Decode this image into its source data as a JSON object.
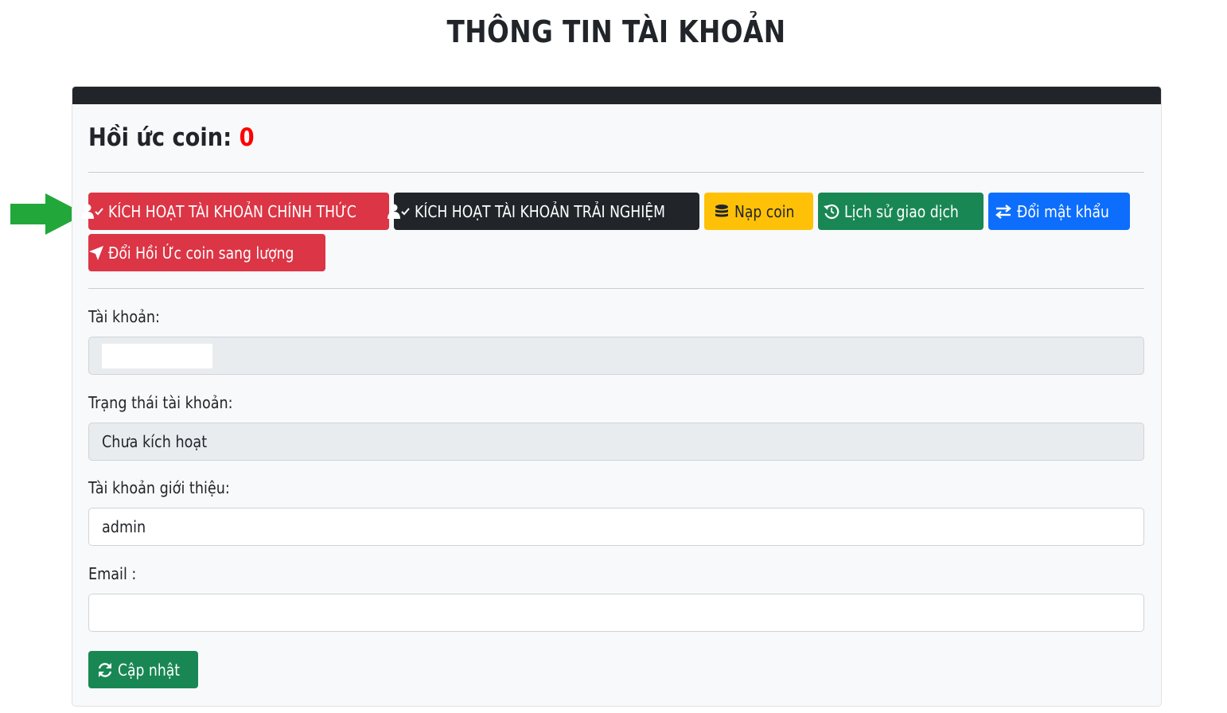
{
  "page": {
    "title": "THÔNG TIN TÀI KHOẢN"
  },
  "coin": {
    "label": "Hồi ức coin:",
    "value": "0"
  },
  "buttons": {
    "activate_official": "KÍCH HOẠT TÀI KHOẢN CHÍNH THỨC",
    "activate_trial": "KÍCH HOẠT TÀI KHOẢN TRẢI NGHIỆM",
    "top_up": "Nạp coin",
    "history": "Lịch sử giao dịch",
    "change_password": "Đổi mật khẩu",
    "convert_coin": "Đổi Hồi Ức coin sang lượng",
    "update": "Cập nhật"
  },
  "form": {
    "account_label": "Tài khoản:",
    "account_value": "",
    "status_label": "Trạng thái tài khoản:",
    "status_value": "Chưa kích hoạt",
    "referrer_label": "Tài khoản giới thiệu:",
    "referrer_value": "admin",
    "email_label": "Email :",
    "email_value": ""
  },
  "icons": {
    "activate_official": "user-check-icon",
    "activate_trial": "user-check-icon",
    "top_up": "coins-icon",
    "history": "history-icon",
    "change_password": "exchange-icon",
    "convert_coin": "location-arrow-icon",
    "update": "refresh-icon",
    "annotations": "green-arrow-icon"
  },
  "colors": {
    "danger": "#dc3545",
    "dark": "#212529",
    "warning": "#ffc107",
    "success": "#198754",
    "primary": "#0d6efd",
    "coin_value": "#ff0000",
    "annotation_arrow": "#22a83a"
  }
}
